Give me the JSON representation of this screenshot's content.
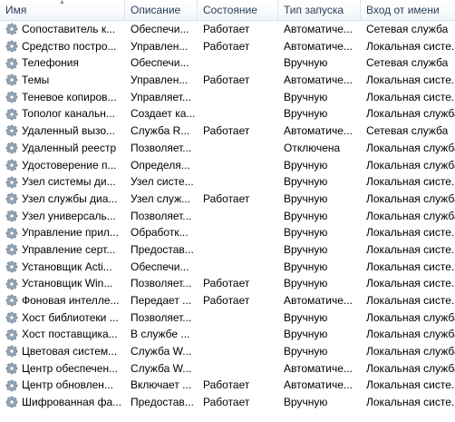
{
  "columns": {
    "name": "Имя",
    "description": "Описание",
    "state": "Состояние",
    "startup": "Тип запуска",
    "login": "Вход от имени"
  },
  "icon": "gear-service-icon",
  "rows": [
    {
      "name": "Сопоставитель к...",
      "description": "Обеспечи...",
      "state": "Работает",
      "startup": "Автоматиче...",
      "login": "Сетевая служба"
    },
    {
      "name": "Средство постро...",
      "description": "Управлен...",
      "state": "Работает",
      "startup": "Автоматиче...",
      "login": "Локальная систе..."
    },
    {
      "name": "Телефония",
      "description": "Обеспечи...",
      "state": "",
      "startup": "Вручную",
      "login": "Сетевая служба"
    },
    {
      "name": "Темы",
      "description": "Управлен...",
      "state": "Работает",
      "startup": "Автоматиче...",
      "login": "Локальная систе..."
    },
    {
      "name": "Теневое копиров...",
      "description": "Управляет...",
      "state": "",
      "startup": "Вручную",
      "login": "Локальная систе..."
    },
    {
      "name": "Тополог канальн...",
      "description": "Создает ка...",
      "state": "",
      "startup": "Вручную",
      "login": "Локальная служба"
    },
    {
      "name": "Удаленный вызо...",
      "description": "Служба R...",
      "state": "Работает",
      "startup": "Автоматиче...",
      "login": "Сетевая служба"
    },
    {
      "name": "Удаленный реестр",
      "description": "Позволяет...",
      "state": "",
      "startup": "Отключена",
      "login": "Локальная служба"
    },
    {
      "name": "Удостоверение п...",
      "description": "Определя...",
      "state": "",
      "startup": "Вручную",
      "login": "Локальная служба"
    },
    {
      "name": "Узел системы ди...",
      "description": "Узел систе...",
      "state": "",
      "startup": "Вручную",
      "login": "Локальная систе..."
    },
    {
      "name": "Узел службы диа...",
      "description": "Узел служ...",
      "state": "Работает",
      "startup": "Вручную",
      "login": "Локальная служба"
    },
    {
      "name": "Узел универсаль...",
      "description": "Позволяет...",
      "state": "",
      "startup": "Вручную",
      "login": "Локальная служба"
    },
    {
      "name": "Управление прил...",
      "description": "Обработк...",
      "state": "",
      "startup": "Вручную",
      "login": "Локальная систе..."
    },
    {
      "name": "Управление серт...",
      "description": "Предостав...",
      "state": "",
      "startup": "Вручную",
      "login": "Локальная систе..."
    },
    {
      "name": "Установщик Acti...",
      "description": "Обеспечи...",
      "state": "",
      "startup": "Вручную",
      "login": "Локальная систе..."
    },
    {
      "name": "Установщик Win...",
      "description": "Позволяет...",
      "state": "Работает",
      "startup": "Вручную",
      "login": "Локальная систе..."
    },
    {
      "name": "Фоновая интелле...",
      "description": "Передает ...",
      "state": "Работает",
      "startup": "Автоматиче...",
      "login": "Локальная систе..."
    },
    {
      "name": "Хост библиотеки ...",
      "description": "Позволяет...",
      "state": "",
      "startup": "Вручную",
      "login": "Локальная служба"
    },
    {
      "name": "Хост поставщика...",
      "description": "В службе ...",
      "state": "",
      "startup": "Вручную",
      "login": "Локальная служба"
    },
    {
      "name": "Цветовая систем...",
      "description": "Служба W...",
      "state": "",
      "startup": "Вручную",
      "login": "Локальная служба"
    },
    {
      "name": "Центр обеспечен...",
      "description": "Служба W...",
      "state": "",
      "startup": "Автоматиче...",
      "login": "Локальная служба"
    },
    {
      "name": "Центр обновлен...",
      "description": "Включает ...",
      "state": "Работает",
      "startup": "Автоматиче...",
      "login": "Локальная систе..."
    },
    {
      "name": "Шифрованная фа...",
      "description": "Предостав...",
      "state": "Работает",
      "startup": "Вручную",
      "login": "Локальная систе..."
    }
  ]
}
